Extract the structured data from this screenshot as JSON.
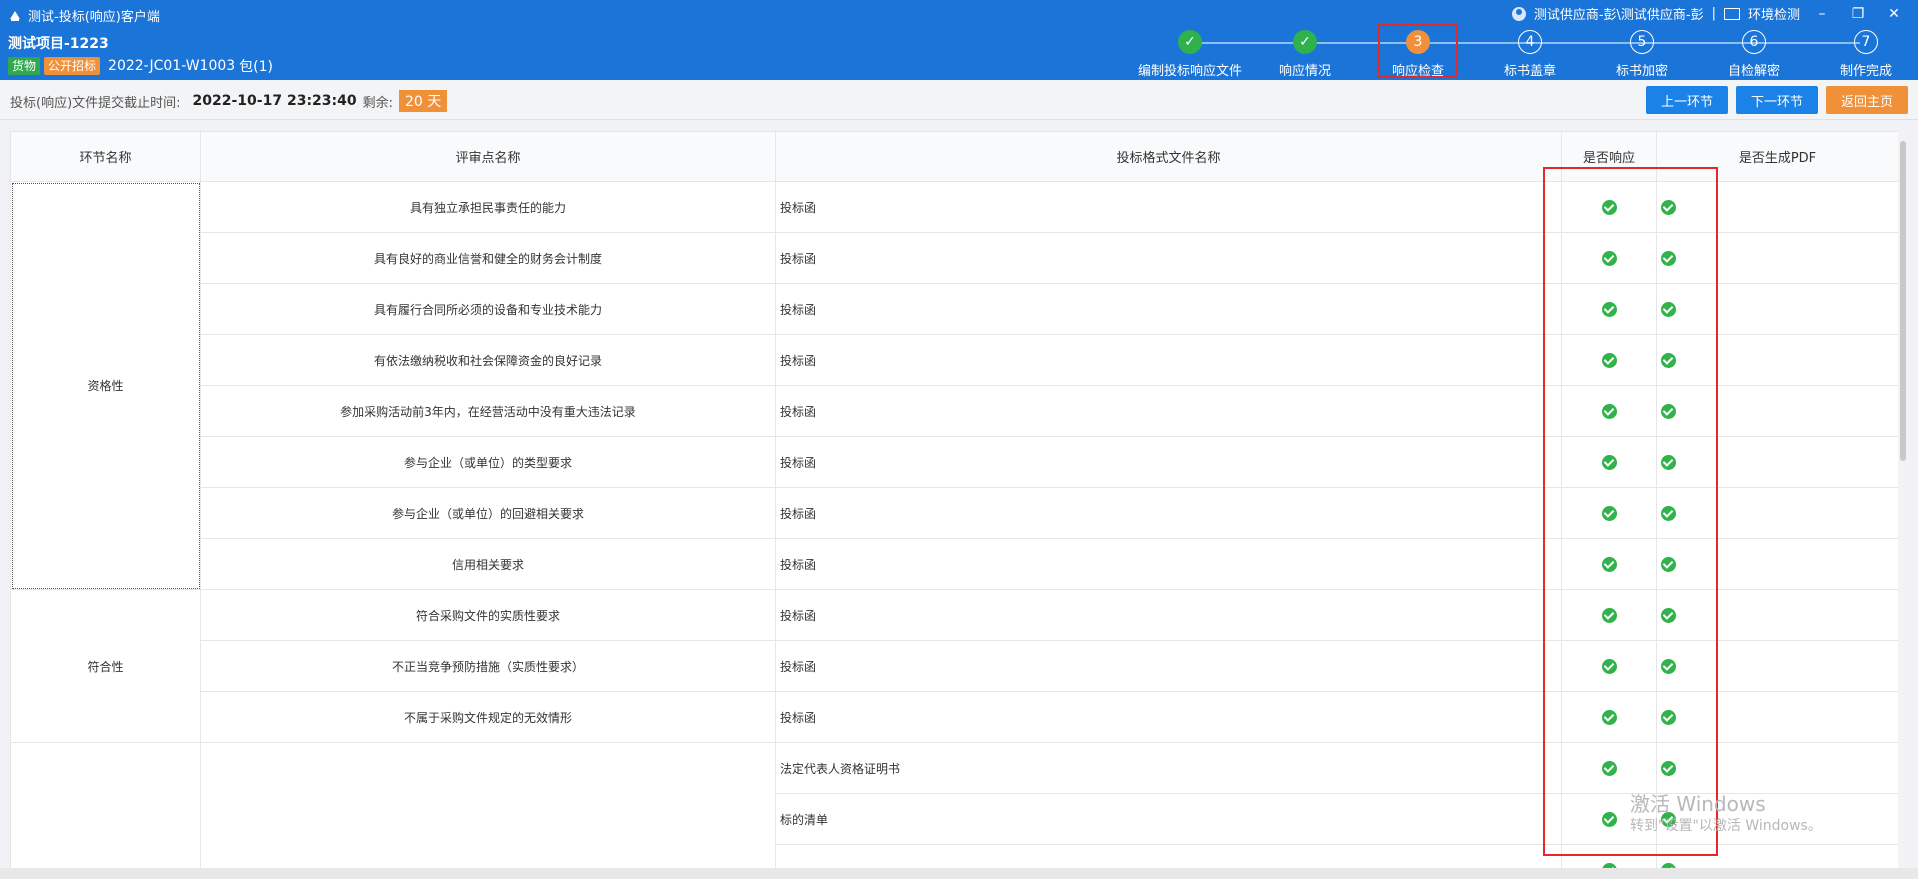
{
  "window": {
    "title": "测试-投标(响应)客户端",
    "user": "测试供应商-彭\\测试供应商-彭",
    "env_check": "环境检测",
    "controls": [
      "–",
      "❐",
      "✕"
    ]
  },
  "project": {
    "name": "测试项目-1223",
    "tag_goods": "货物",
    "tag_method": "公开招标",
    "code": "2022-JC01-W1003",
    "package": "包(1)"
  },
  "steps": [
    {
      "num": "✓",
      "label": "编制投标响应文件",
      "state": "done"
    },
    {
      "num": "✓",
      "label": "响应情况",
      "state": "done"
    },
    {
      "num": "3",
      "label": "响应检查",
      "state": "current"
    },
    {
      "num": "4",
      "label": "标书盖章",
      "state": "todo"
    },
    {
      "num": "5",
      "label": "标书加密",
      "state": "todo"
    },
    {
      "num": "6",
      "label": "自检解密",
      "state": "todo"
    },
    {
      "num": "7",
      "label": "制作完成",
      "state": "todo"
    }
  ],
  "deadline": {
    "label": "投标(响应)文件提交截止时间:",
    "time": "2022-10-17 23:23:40",
    "remain_label": "剩余:",
    "remain_value": "20 天"
  },
  "buttons": {
    "prev": "上一环节",
    "next": "下一环节",
    "home": "返回主页"
  },
  "table": {
    "headers": [
      "环节名称",
      "评审点名称",
      "投标格式文件名称",
      "是否响应",
      "是否生成PDF"
    ],
    "rows": [
      {
        "stage": "资格性",
        "point": "具有独立承担民事责任的能力",
        "doc": "投标函"
      },
      {
        "point": "具有良好的商业信誉和健全的财务会计制度",
        "doc": "投标函"
      },
      {
        "point": "具有履行合同所必须的设备和专业技术能力",
        "doc": "投标函"
      },
      {
        "point": "有依法缴纳税收和社会保障资金的良好记录",
        "doc": "投标函"
      },
      {
        "point": "参加采购活动前3年内，在经营活动中没有重大违法记录",
        "doc": "投标函"
      },
      {
        "point": "参与企业（或单位）的类型要求",
        "doc": "投标函"
      },
      {
        "point": "参与企业（或单位）的回避相关要求",
        "doc": "投标函"
      },
      {
        "point": "信用相关要求",
        "doc": "投标函"
      },
      {
        "stage": "符合性",
        "point": "符合采购文件的实质性要求",
        "doc": "投标函"
      },
      {
        "point": "不正当竞争预防措施（实质性要求）",
        "doc": "投标函"
      },
      {
        "point": "不属于采购文件规定的无效情形",
        "doc": "投标函"
      },
      {
        "stage": "",
        "point": "",
        "doc": "法定代表人资格证明书"
      },
      {
        "point": "",
        "doc": "标的清单"
      },
      {
        "point": "",
        "doc": ""
      }
    ]
  },
  "watermark": {
    "line1": "激活 Windows",
    "line2": "转到\"设置\"以激活 Windows。"
  }
}
